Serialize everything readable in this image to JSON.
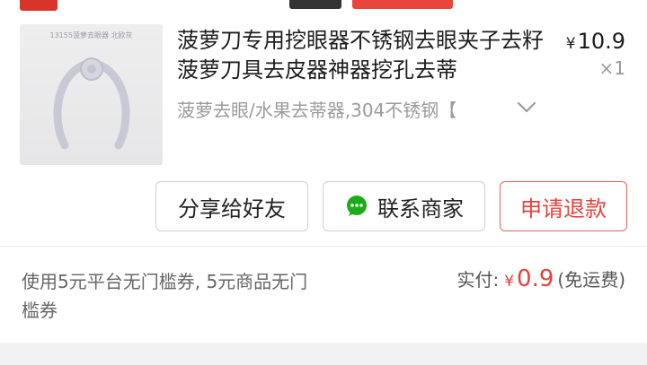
{
  "order": {
    "thumb_caption": "13155菠萝去眼器 北欧灰",
    "title": "菠萝刀专用挖眼器不锈钢去眼夹子去籽菠萝刀具去皮器神器挖孔去蒂",
    "price_symbol": "¥",
    "price": "10.9",
    "quantity": "×1",
    "spec": "菠萝去眼/水果去蒂器,304不锈钢【"
  },
  "actions": {
    "share_label": "分享给好友",
    "contact_label": "联系商家",
    "refund_label": "申请退款"
  },
  "summary": {
    "coupon_text": "使用5元平台无门槛券, 5元商品无门槛券",
    "paid_label": "实付:",
    "paid_symbol": "¥",
    "paid_amount": "0.9",
    "shipping_note": "(免运费)"
  },
  "icons": {
    "chat": "chat-bubble-icon",
    "chevron": "chevron-down-icon"
  },
  "colors": {
    "accent_red": "#e8403a",
    "wechat_green": "#1aad19"
  }
}
